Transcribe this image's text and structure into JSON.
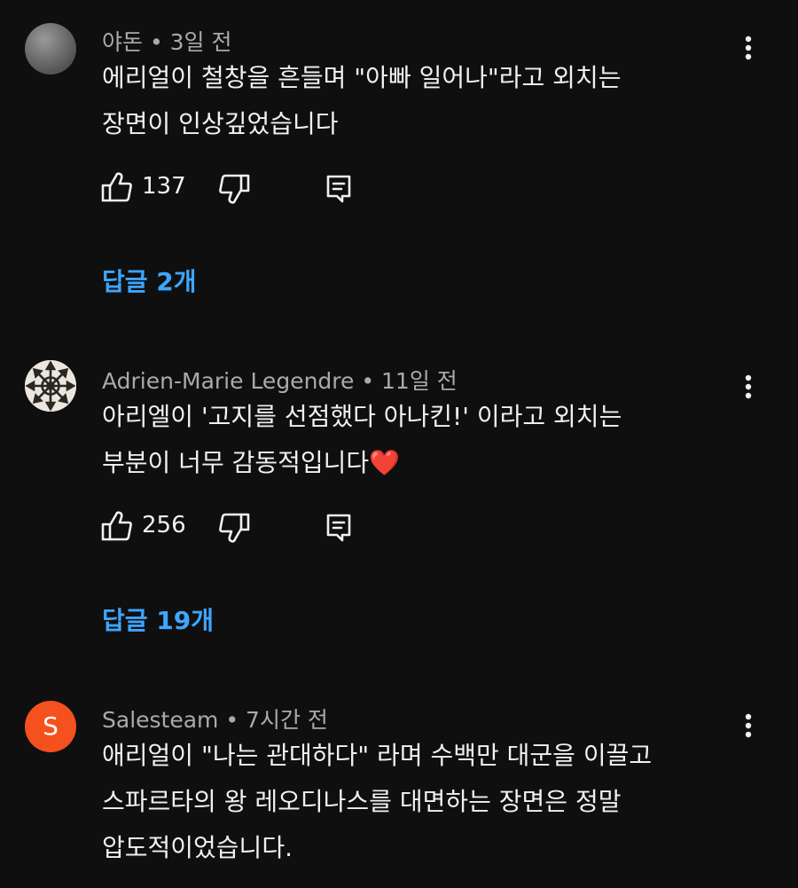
{
  "comments": [
    {
      "author": "야돈",
      "time": "3일 전",
      "avatar": {
        "type": "grey-sphere"
      },
      "lines": [
        "에리얼이 철창을 흔들며 \"아빠 일어나\"라고 외치는",
        "장면이 인상깊었습니다"
      ],
      "likes": "137",
      "replies": "답글 2개"
    },
    {
      "author": "Adrien-Marie Legendre",
      "time": "11일 전",
      "avatar": {
        "type": "chaos-star-emblem"
      },
      "lines": [
        "아리엘이 '고지를 선점했다 아나킨!' 이라고 외치는",
        "부분이 너무 감동적입니다"
      ],
      "emoji": "❤️",
      "likes": "256",
      "replies": "답글 19개"
    },
    {
      "author": "Salesteam",
      "time": "7시간 전",
      "avatar": {
        "type": "letter",
        "letter": "S",
        "color": "#f4511e"
      },
      "lines": [
        "애리얼이 \"나는 관대하다\" 라며 수백만 대군을 이끌고",
        "스파르타의 왕 레오디나스를 대면하는 장면은 정말",
        "압도적이었습니다."
      ]
    }
  ],
  "separator": " • ",
  "icons": {
    "like": "thumbs-up-icon",
    "dislike": "thumbs-down-icon",
    "reply": "reply-icon",
    "menu": "more-vertical-icon"
  },
  "colors": {
    "background": "#0f0f0f",
    "text": "#f1f1f1",
    "meta": "#aaaaaa",
    "link": "#3ea6ff",
    "avatar_s": "#f4511e",
    "heart": "#ff2d3a"
  }
}
